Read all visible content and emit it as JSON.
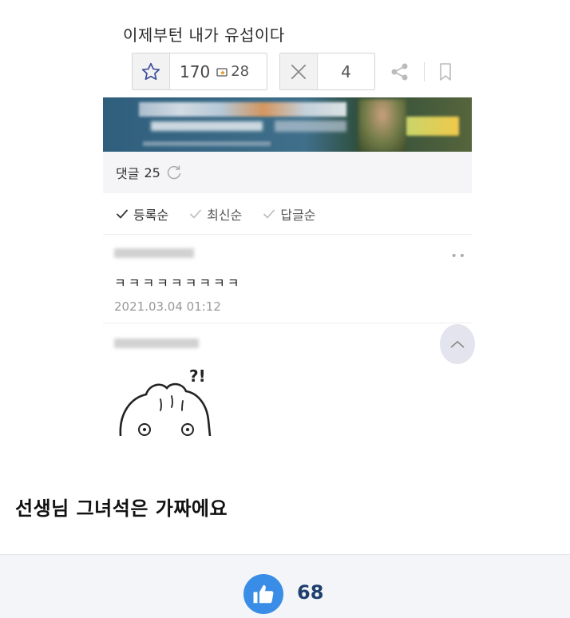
{
  "post": {
    "title": "이제부턴 내가 유섭이다",
    "recommend_count": "170",
    "small_count": "28",
    "not_recommend_count": "4"
  },
  "comments": {
    "label": "댓글",
    "count": "25",
    "sort_options": [
      "등록순",
      "최신순",
      "답글순"
    ],
    "items": [
      {
        "text": "ㅋㅋㅋㅋㅋㅋㅋㅋㅋ",
        "date": "2021.03.04 01:12"
      }
    ]
  },
  "caption": "선생님 그녀석은 가짜에요",
  "footer": {
    "like_count": "68"
  },
  "colors": {
    "like_blue": "#3a8de6",
    "like_count": "#1f3f6e",
    "footer_bg": "#f3f5f8"
  }
}
